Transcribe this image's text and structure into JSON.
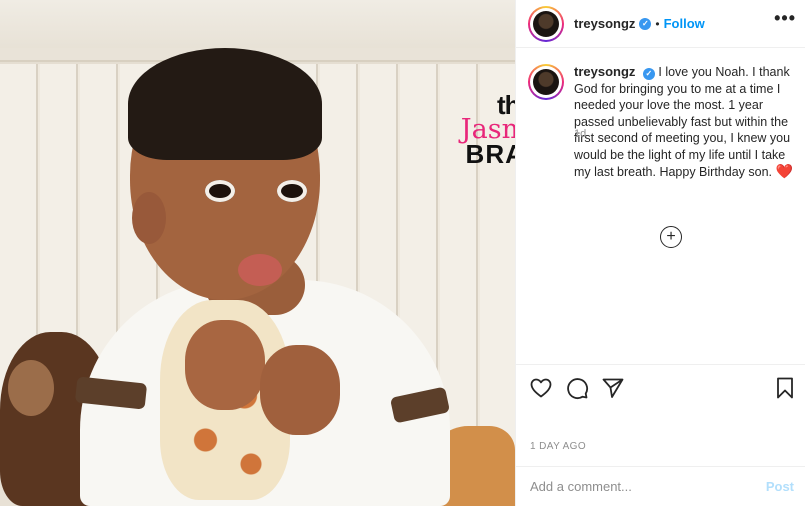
{
  "post": {
    "username": "treysongz",
    "verified_mark": "✓",
    "dot": "•",
    "follow_label": "Follow",
    "more_label": "•••",
    "caption": "I love you Noah. I thank God for bringing you to me at a time I needed your love the most. 1 year passed unbelievably fast but within the first second of meeting you, I knew you would be the light of my life until I take my last breath. Happy Birthday son.",
    "caption_emoji": "❤️",
    "caption_time": "1d",
    "load_more_symbol": "+",
    "date": "1 DAY AGO"
  },
  "watermark": {
    "line1": "the",
    "line2": "Jasmine",
    "line3": "BRAND"
  },
  "comment": {
    "placeholder": "Add a comment...",
    "post_label": "Post"
  },
  "icons": {
    "like": "heart-icon",
    "comment": "comment-icon",
    "share": "paper-plane-icon",
    "save": "bookmark-icon"
  },
  "colors": {
    "link_blue": "#0095f6",
    "verified_blue": "#3897f0",
    "post_disabled": "#b2dffc",
    "muted": "#8e8e8e",
    "watermark_pink": "#e8267a"
  }
}
